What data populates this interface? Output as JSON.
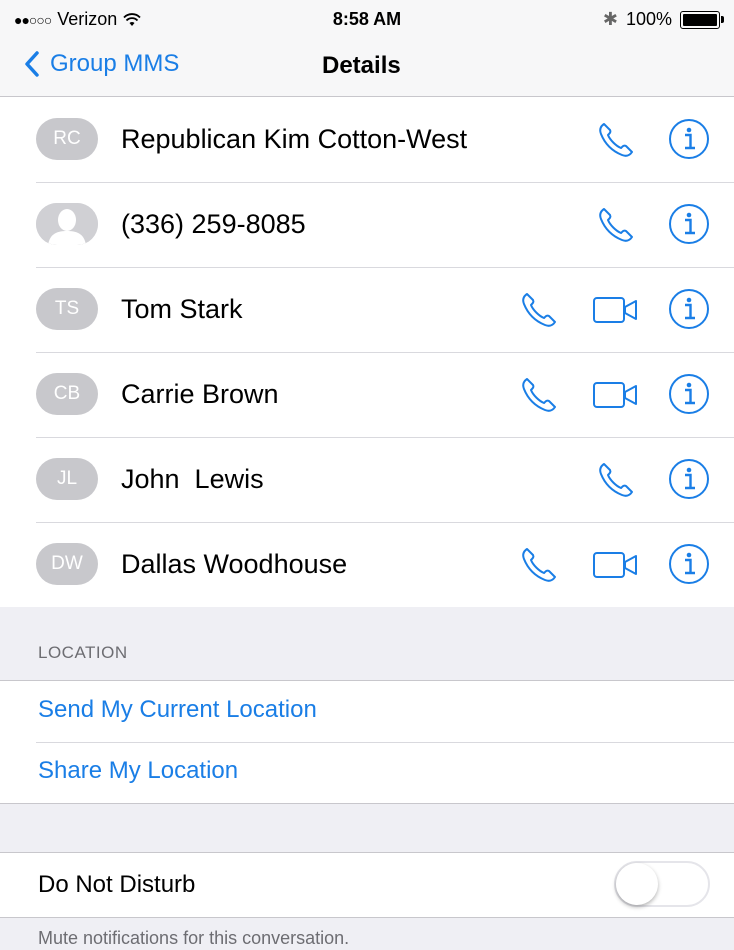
{
  "status_bar": {
    "signal": "●●○○○",
    "carrier": "Verizon",
    "wifi_icon": "wifi-icon",
    "time": "8:58 AM",
    "bluetooth": "✱",
    "battery": "100%"
  },
  "nav": {
    "back_label": "Group MMS",
    "title": "Details"
  },
  "contacts": [
    {
      "initials": "RC",
      "name": "Republican Kim Cotton-West",
      "has_video": false
    },
    {
      "initials": "",
      "name": "(336) 259-8085",
      "has_video": false
    },
    {
      "initials": "TS",
      "name": "Tom Stark",
      "has_video": true
    },
    {
      "initials": "CB",
      "name": "Carrie Brown",
      "has_video": true
    },
    {
      "initials": "JL",
      "name": "John  Lewis",
      "has_video": false
    },
    {
      "initials": "DW",
      "name": "Dallas Woodhouse",
      "has_video": true
    }
  ],
  "location": {
    "header": "LOCATION",
    "send_current": "Send My Current Location",
    "share": "Share My Location"
  },
  "dnd": {
    "label": "Do Not Disturb",
    "enabled": false,
    "footer": "Mute notifications for this conversation."
  },
  "colors": {
    "accent": "#1a7ee6",
    "avatar": "#c8c8cc",
    "background": "#efeff4"
  }
}
